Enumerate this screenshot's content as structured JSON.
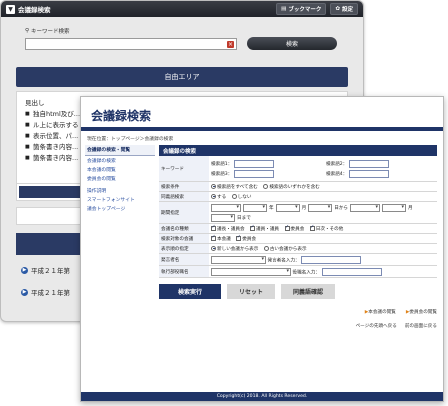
{
  "back": {
    "app_title": "会議録検索",
    "bookmark_label": "ブックマーク",
    "settings_label": "設定",
    "search_label": "キーワード検索",
    "search_button": "検索",
    "free_area": "自由エリア",
    "body_title": "見出し",
    "body_items": [
      "独自html及び...",
      "表示位置、パ...",
      "箇条書き内容...",
      "箇条書き内容..."
    ],
    "body_line2": "ル上に表示する",
    "list_items": [
      "平成２１年第",
      "平成２１年第"
    ]
  },
  "front": {
    "title": "会議録検索",
    "breadcrumb": "現在位置：トップページ＞会議録の検索",
    "sidebar": {
      "header": "会議録の検索・閲覧",
      "links": [
        "会議録の検索",
        "本会議の閲覧",
        "委員会の閲覧"
      ],
      "links2": [
        "操作説明",
        "スマートフォンサイト",
        "議会トップページ"
      ]
    },
    "section_title": "会議録の検索",
    "form": {
      "keyword_label": "キーワード",
      "kw1": "検索語1：",
      "kw2": "検索語2：",
      "kw3": "検索語3：",
      "kw4": "検索語4：",
      "cond_label": "検索条件",
      "cond_opts": [
        "検索語をすべて含む",
        "検索語のいずれかを含む"
      ],
      "sync_label": "同義語検索",
      "sync_opts": [
        "する",
        "しない"
      ],
      "period_label": "期間指定",
      "year_unit": "年",
      "month_unit": "月",
      "day_from": "日から",
      "day_to": "日まで",
      "type_label": "会議名の種類",
      "types": [
        "議長・議員会",
        "議員・議員",
        "委員会",
        "日次・その他"
      ],
      "target_label": "検索対象の会議",
      "targets": [
        "本会議",
        "委員会"
      ],
      "order_label": "表示順の指定",
      "orders": [
        "新しい会議から表示",
        "古い会議から表示"
      ],
      "speaker_label": "発言者名",
      "speaker_input_label": "発言者名入力：",
      "exec_label": "執行部役職名",
      "pos_input_label": "役職名入力："
    },
    "buttons": {
      "run": "検索実行",
      "reset": "リセット",
      "synonym": "同義語確認"
    },
    "links1": [
      "本会議の閲覧",
      "委員会の閲覧"
    ],
    "links2": [
      "ページの先頭へ戻る",
      "前の画面に戻る"
    ],
    "footer": "Copyright(c) 2018. All Rights Reserved."
  }
}
